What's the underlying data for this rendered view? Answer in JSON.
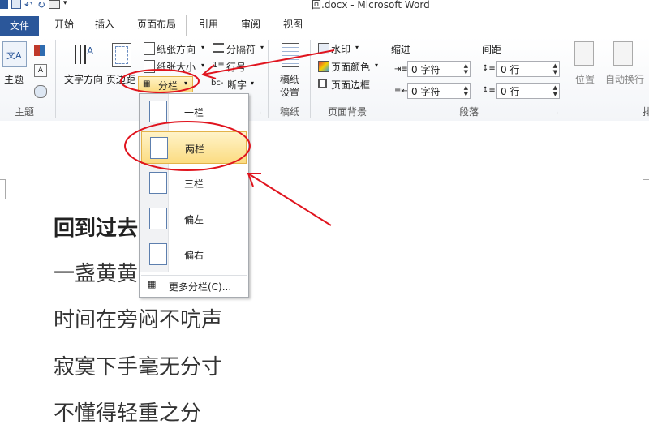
{
  "window": {
    "title": "回.docx  -  Microsoft Word"
  },
  "tabs": [
    {
      "label": "文件"
    },
    {
      "label": "开始"
    },
    {
      "label": "插入"
    },
    {
      "label": "页面布局"
    },
    {
      "label": "引用"
    },
    {
      "label": "审阅"
    },
    {
      "label": "视图"
    }
  ],
  "ribbon": {
    "theme": {
      "themes_label": "主题",
      "group_label": "主题"
    },
    "page_setup": {
      "text_direction_label": "文字方向",
      "margins_label": "页边距",
      "orientation_label": "纸张方向",
      "size_label": "纸张大小",
      "columns_label": "分栏",
      "breaks_label": "分隔符",
      "line_numbers_label": "行号",
      "hyphenation_label": "断字"
    },
    "draft": {
      "settings_label_1": "稿纸",
      "settings_label_2": "设置",
      "group_label": "稿纸"
    },
    "background": {
      "watermark_label": "水印",
      "page_color_label": "页面颜色",
      "page_borders_label": "页面边框",
      "group_label": "页面背景"
    },
    "paragraph": {
      "indent_label": "缩进",
      "spacing_label": "间距",
      "indent_left_value": "0 字符",
      "indent_right_value": "0 字符",
      "spacing_before_value": "0 行",
      "spacing_after_value": "0 行",
      "group_label": "段落"
    },
    "arrange": {
      "position_label": "位置",
      "wrap_label": "自动换行",
      "group_label_partial": "排"
    }
  },
  "columns_menu": {
    "items": [
      {
        "label": "一栏"
      },
      {
        "label": "两栏"
      },
      {
        "label": "三栏"
      },
      {
        "label": "偏左"
      },
      {
        "label": "偏右"
      }
    ],
    "more_label": "更多分栏(C)..."
  },
  "document": {
    "title_visible": "回到过去",
    "lines": [
      "一盏黄黄",
      "时间在旁闷不吭声",
      "寂寞下手毫无分寸",
      "不懂得轻重之分"
    ]
  },
  "colors": {
    "file_tab": "#2b579a",
    "highlight": "#fbdc82",
    "annotation": "#e0141e"
  }
}
